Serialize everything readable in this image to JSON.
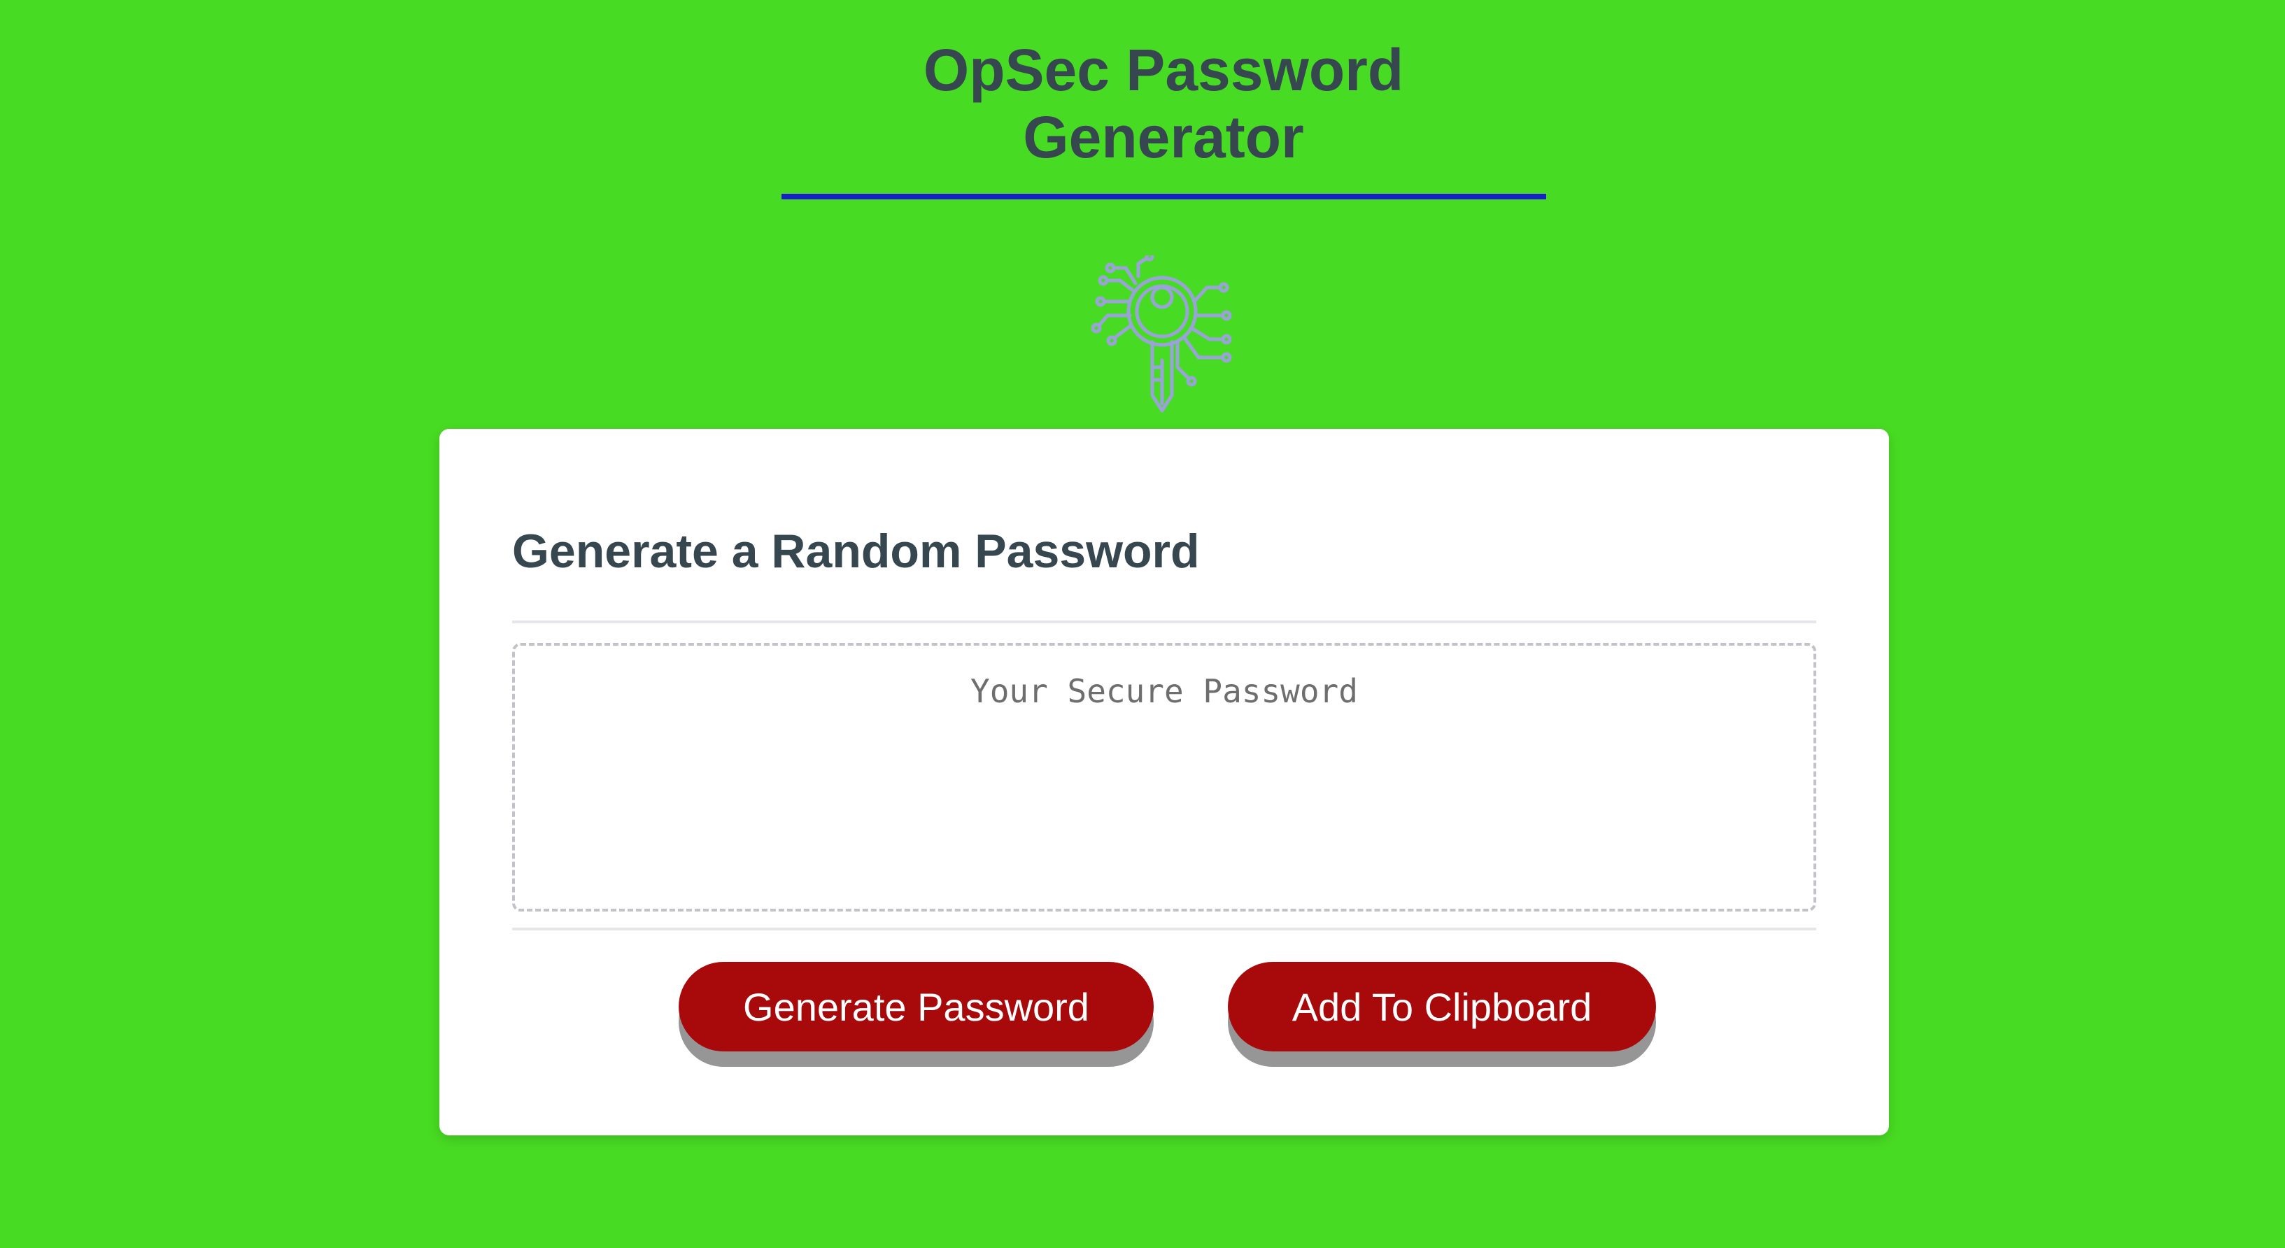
{
  "header": {
    "title_line1": "OpSec Password",
    "title_line2": "Generator",
    "underline_color": "#1820c8"
  },
  "logo": {
    "icon": "circuit-key-icon",
    "color": "#9aa3d8"
  },
  "card": {
    "heading": "Generate a Random Password",
    "password_field": {
      "value": "",
      "placeholder": "Your Secure Password"
    },
    "buttons": {
      "generate_label": "Generate Password",
      "clipboard_label": "Add To Clipboard"
    }
  },
  "colors": {
    "page_background": "#48db23",
    "heading_text": "#36474f",
    "button_background": "#a80a0c",
    "button_text": "#ffffff",
    "button_shadow": "#969696"
  }
}
